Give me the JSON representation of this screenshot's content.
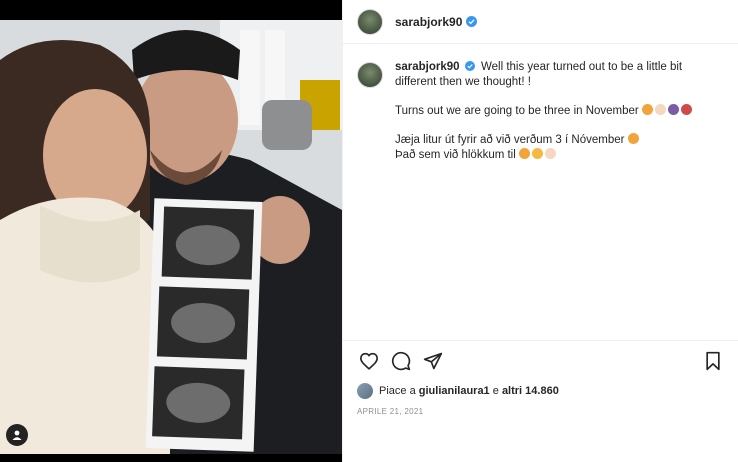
{
  "post": {
    "username": "sarabjork90",
    "caption": {
      "line1": "Well this year turned out to be a little bit different then we thought! !",
      "line2": "Turns out we are going to be three in November",
      "line3": "Jæja litur út fyrir að við verðum 3 í Nóvember",
      "line4": "Það sem við hlökkum til"
    },
    "likes": {
      "prefix": "Piace a",
      "user": "giulianilaura1",
      "middle": "e",
      "others": "altri 14.860"
    },
    "date": "APRILE 21, 2021"
  },
  "icons": {
    "verified": "verified-badge-icon",
    "like": "heart-icon",
    "comment": "comment-icon",
    "share": "paper-plane-icon",
    "save": "bookmark-icon",
    "tag": "user-tag-icon"
  },
  "colors": {
    "verified": "#3897f0",
    "emoji": "#f2a33a"
  }
}
